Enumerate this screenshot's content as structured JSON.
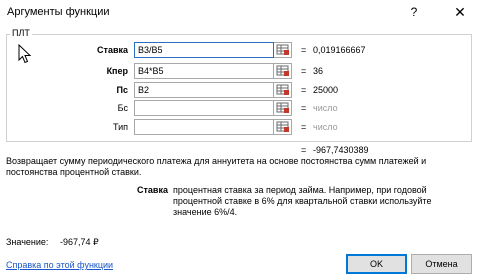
{
  "window": {
    "title": "Аргументы функции",
    "help_glyph": "?",
    "close_glyph": "✕"
  },
  "function_name": "ПЛТ",
  "arguments": [
    {
      "label": "Ставка",
      "value": "B3/B5",
      "result": "0,019166667",
      "result_muted": false,
      "required": true
    },
    {
      "label": "Кпер",
      "value": "B4*B5",
      "result": "36",
      "result_muted": false,
      "required": true
    },
    {
      "label": "Пс",
      "value": "B2",
      "result": "25000",
      "result_muted": false,
      "required": true
    },
    {
      "label": "Бс",
      "value": "",
      "result": "число",
      "result_muted": true,
      "required": false
    },
    {
      "label": "Тип",
      "value": "",
      "result": "число",
      "result_muted": true,
      "required": false
    }
  ],
  "equals_sign": "=",
  "formula_result": "-967,7430389",
  "description": "Возвращает сумму периодического платежа для аннуитета на основе постоянства сумм платежей и постоянства процентной ставки.",
  "arg_help": {
    "name": "Ставка",
    "text": "процентная ставка за период займа. Например, при годовой процентной ставке в 6% для квартальной ставки используйте значение 6%/4."
  },
  "value_label": "Значение:",
  "value": "-967,74 ₽",
  "help_link": "Справка по этой функции",
  "buttons": {
    "ok": "OK",
    "cancel": "Отмена"
  },
  "colors": {
    "link": "#1a56c9",
    "focus_border": "#0078d7",
    "muted_text": "#9a9a9a"
  },
  "icons": {
    "ref_button": "collapse-dialog-icon",
    "cursor": "mouse-pointer-icon"
  }
}
